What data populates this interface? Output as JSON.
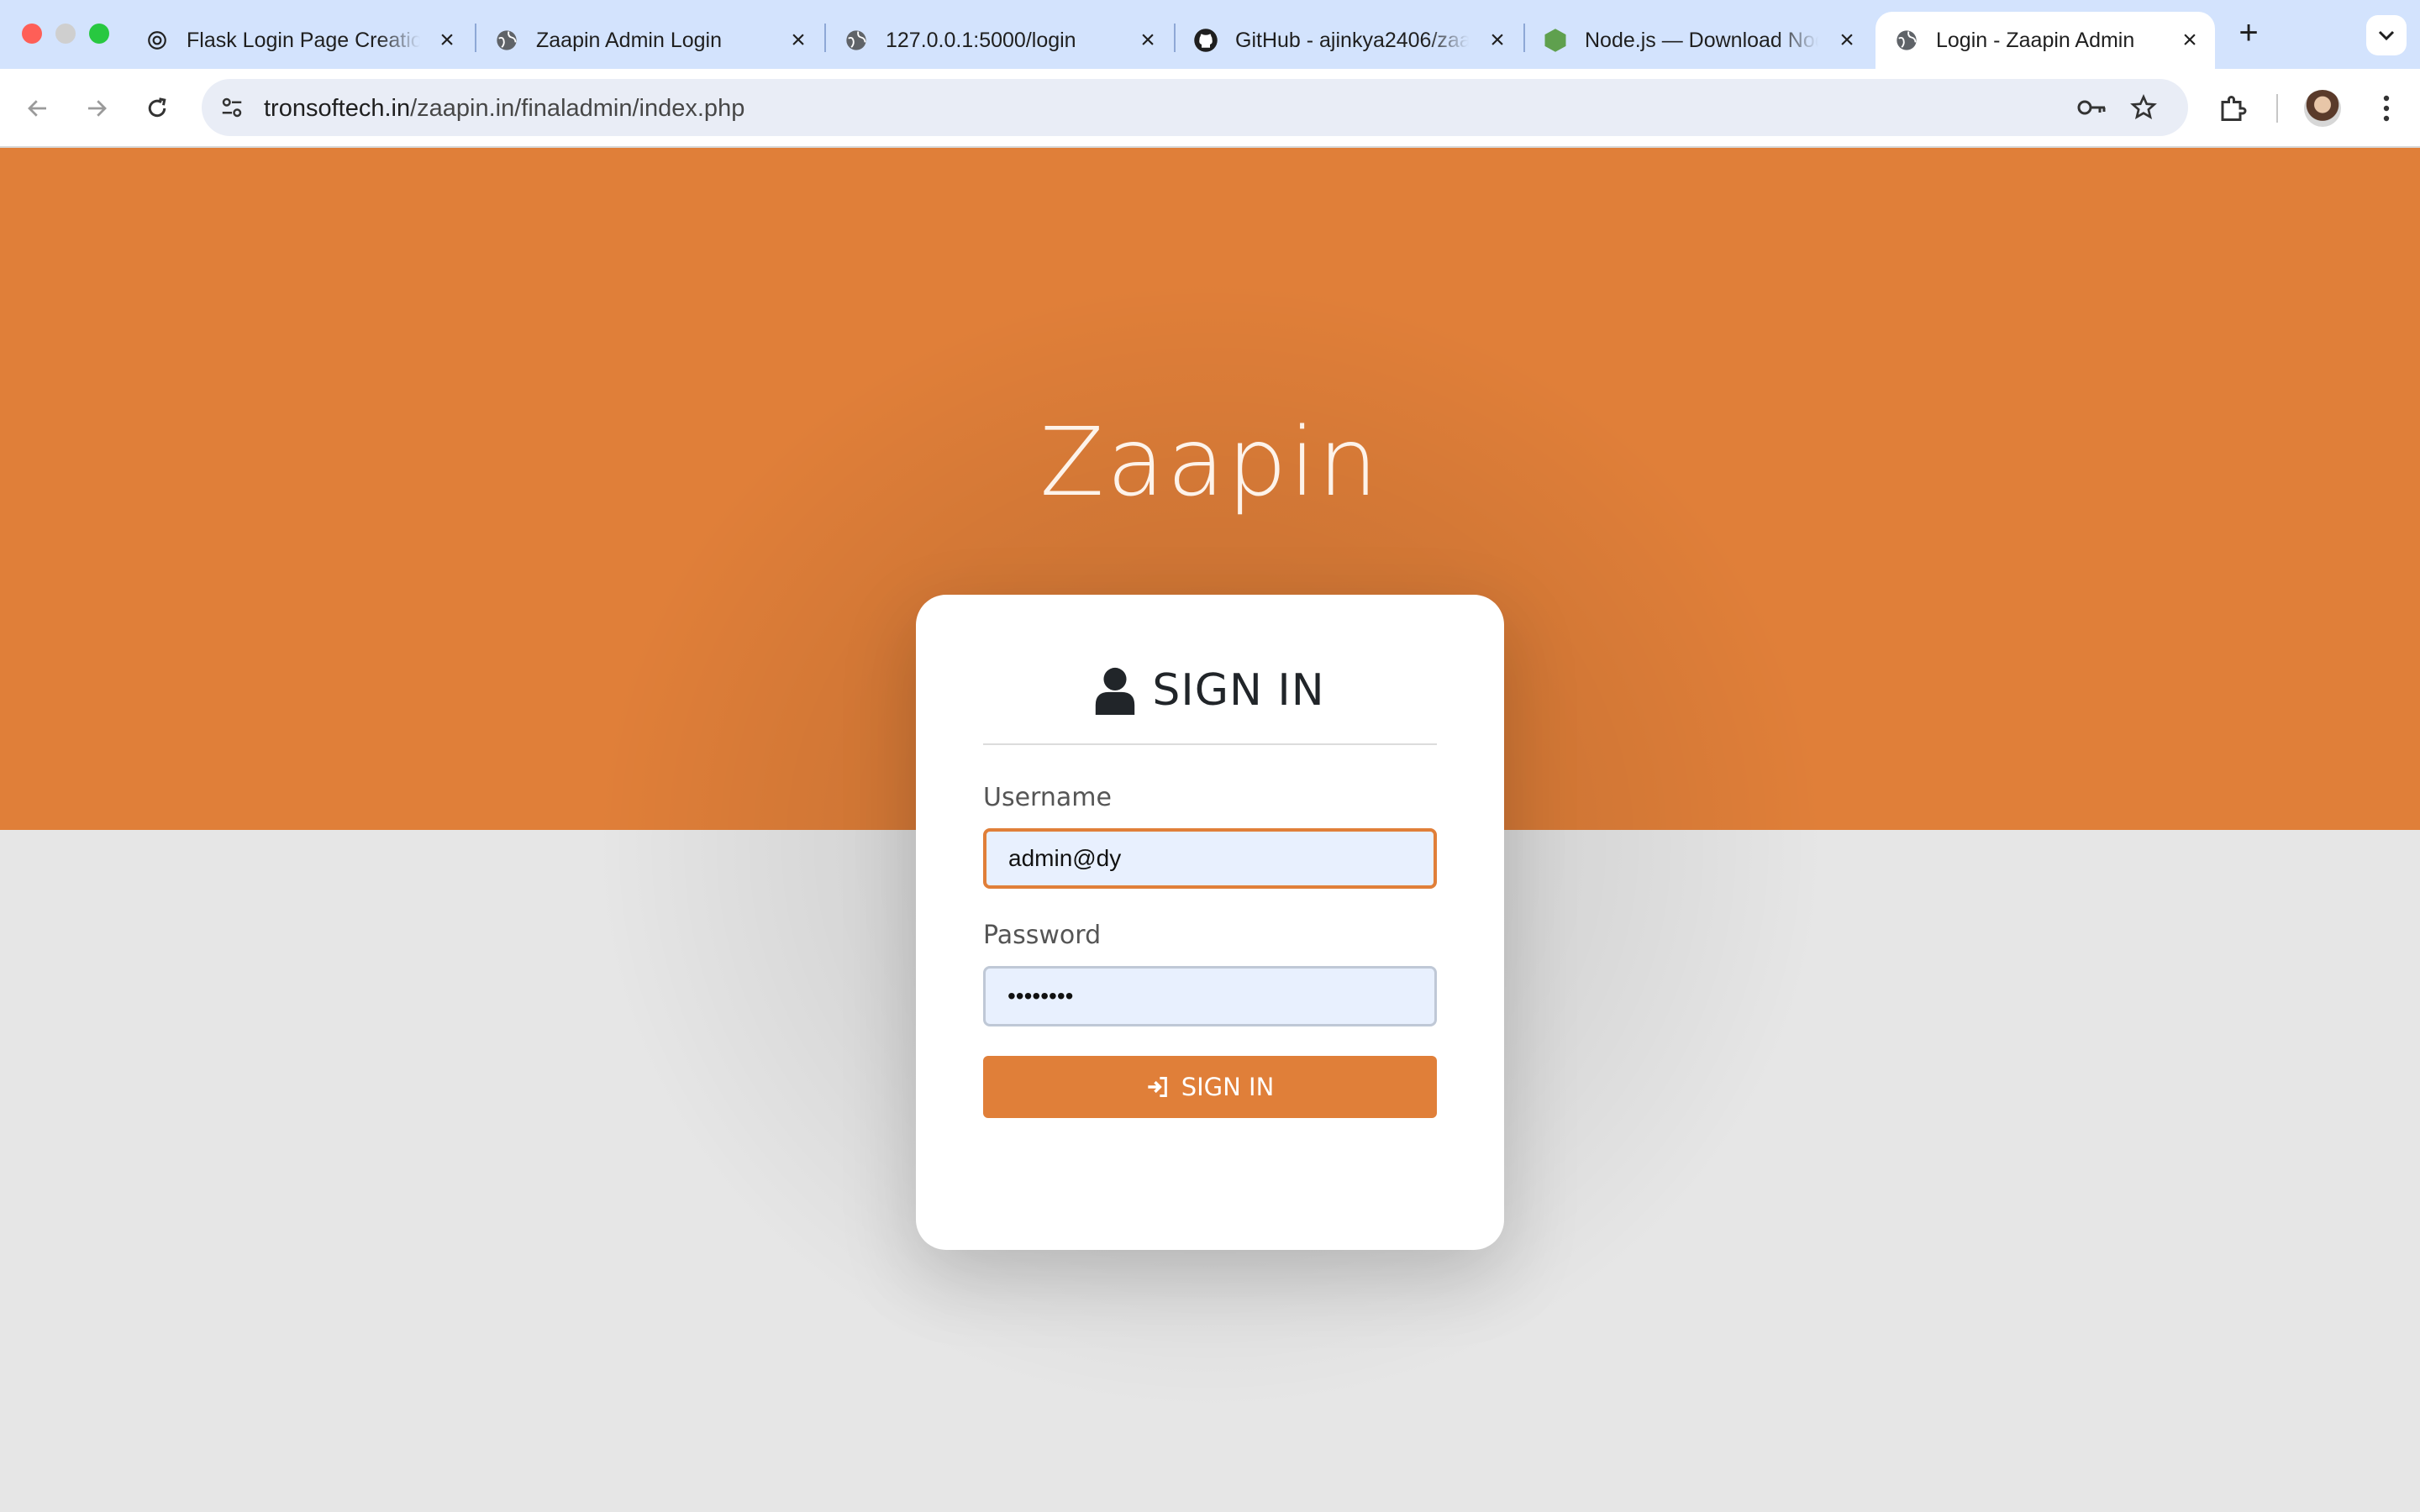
{
  "browser": {
    "tabs": [
      {
        "title": "Flask Login Page Creation",
        "favicon": "openai-icon"
      },
      {
        "title": "Zaapin Admin Login",
        "favicon": "globe-icon"
      },
      {
        "title": "127.0.0.1:5000/login",
        "favicon": "globe-icon"
      },
      {
        "title": "GitHub - ajinkya2406/zaapin",
        "favicon": "github-icon"
      },
      {
        "title": "Node.js — Download Node.js",
        "favicon": "nodejs-icon"
      },
      {
        "title": "Login - Zaapin Admin",
        "favicon": "globe-icon",
        "active": true
      }
    ],
    "address": {
      "domain": "tronsoftech.in",
      "path": "/zaapin.in/finaladmin/index.php"
    }
  },
  "page": {
    "brand": "Zaapin",
    "card_title": "SIGN IN",
    "username_label": "Username",
    "username_value": "admin@dy",
    "password_label": "Password",
    "password_value": "••••••••",
    "submit_label": "SIGN IN"
  },
  "colors": {
    "accent": "#e07f39",
    "background": "#e6e6e6",
    "tabstrip": "#d3e3fd"
  }
}
